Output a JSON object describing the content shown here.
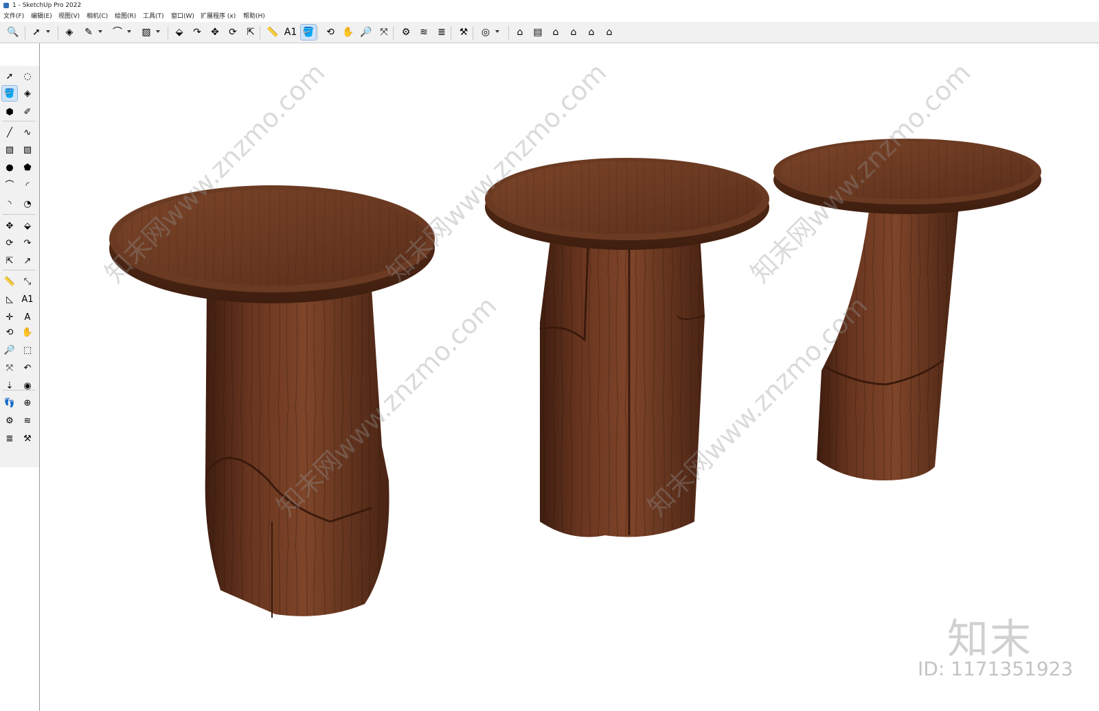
{
  "window": {
    "title": "1 - SketchUp Pro 2022"
  },
  "menu": [
    {
      "label": "文件(F)"
    },
    {
      "label": "编辑(E)"
    },
    {
      "label": "视图(V)"
    },
    {
      "label": "相机(C)"
    },
    {
      "label": "绘图(R)"
    },
    {
      "label": "工具(T)"
    },
    {
      "label": "窗口(W)"
    },
    {
      "label": "扩展程序 (x)"
    },
    {
      "label": "帮助(H)"
    }
  ],
  "top_toolbar": [
    {
      "icon": "zoom-icon",
      "glyph": "🔍"
    },
    {
      "icon": "select-icon",
      "glyph": "➚",
      "dropdown": true
    },
    {
      "icon": "eraser-icon",
      "glyph": "◈"
    },
    {
      "icon": "pencil-icon",
      "glyph": "✎",
      "dropdown": true
    },
    {
      "icon": "arc-icon",
      "glyph": "⌒",
      "dropdown": true
    },
    {
      "icon": "rectangle-icon",
      "glyph": "▨",
      "dropdown": true
    },
    {
      "icon": "push-pull-icon",
      "glyph": "⬙"
    },
    {
      "icon": "follow-me-icon",
      "glyph": "↷"
    },
    {
      "icon": "move-icon",
      "glyph": "✥"
    },
    {
      "icon": "rotate-icon",
      "glyph": "⟳"
    },
    {
      "icon": "scale-icon",
      "glyph": "⇱"
    },
    {
      "icon": "tape-measure-icon",
      "glyph": "📏"
    },
    {
      "icon": "text-icon",
      "glyph": "A1"
    },
    {
      "icon": "paint-bucket-icon",
      "glyph": "🪣",
      "active": true
    },
    {
      "icon": "orbit-icon",
      "glyph": "⟲"
    },
    {
      "icon": "pan-icon",
      "glyph": "✋"
    },
    {
      "icon": "zoom-tool-icon",
      "glyph": "🔎"
    },
    {
      "icon": "zoom-extents-icon",
      "glyph": "⤧"
    },
    {
      "icon": "warehouse-icon",
      "glyph": "⚙"
    },
    {
      "icon": "extension-warehouse-icon",
      "glyph": "≋"
    },
    {
      "icon": "layers-icon",
      "glyph": "≣"
    },
    {
      "icon": "extension-manager-icon",
      "glyph": "⚒"
    },
    {
      "icon": "account-icon",
      "glyph": "◎",
      "dropdown": true
    },
    {
      "icon": "iso-view-icon",
      "glyph": "⌂"
    },
    {
      "icon": "top-view-icon",
      "glyph": "▤"
    },
    {
      "icon": "front-view-icon",
      "glyph": "⌂"
    },
    {
      "icon": "right-view-icon",
      "glyph": "⌂"
    },
    {
      "icon": "back-view-icon",
      "glyph": "⌂"
    },
    {
      "icon": "left-view-icon",
      "glyph": "⌂"
    }
  ],
  "left_toolbar": [
    {
      "icon": "select-icon",
      "glyph": "➚"
    },
    {
      "icon": "lasso-icon",
      "glyph": "◌"
    },
    {
      "icon": "paint-bucket-icon",
      "glyph": "🪣",
      "active": true
    },
    {
      "icon": "eraser-icon",
      "glyph": "◈"
    },
    {
      "icon": "make-component-icon",
      "glyph": "⬢"
    },
    {
      "icon": "tag-tool-icon",
      "glyph": "✐"
    },
    {
      "icon": "line-icon",
      "glyph": "╱"
    },
    {
      "icon": "freehand-icon",
      "glyph": "∿"
    },
    {
      "icon": "rectangle-icon",
      "glyph": "▨"
    },
    {
      "icon": "rotated-rectangle-icon",
      "glyph": "▧"
    },
    {
      "icon": "circle-icon",
      "glyph": "●"
    },
    {
      "icon": "polygon-icon",
      "glyph": "⬟"
    },
    {
      "icon": "arc-icon",
      "glyph": "⌒"
    },
    {
      "icon": "two-point-arc-icon",
      "glyph": "◜"
    },
    {
      "icon": "three-point-arc-icon",
      "glyph": "◝"
    },
    {
      "icon": "pie-icon",
      "glyph": "◔"
    },
    {
      "icon": "move-icon",
      "glyph": "✥"
    },
    {
      "icon": "push-pull-icon",
      "glyph": "⬙"
    },
    {
      "icon": "rotate-icon",
      "glyph": "⟳"
    },
    {
      "icon": "follow-me-icon",
      "glyph": "↷"
    },
    {
      "icon": "scale-icon",
      "glyph": "⇱"
    },
    {
      "icon": "offset-icon",
      "glyph": "↗"
    },
    {
      "icon": "tape-measure-icon",
      "glyph": "📏"
    },
    {
      "icon": "dimension-icon",
      "glyph": "⤡"
    },
    {
      "icon": "protractor-icon",
      "glyph": "◺"
    },
    {
      "icon": "text-icon",
      "glyph": "A1"
    },
    {
      "icon": "axes-icon",
      "glyph": "✛"
    },
    {
      "icon": "3d-text-icon",
      "glyph": "A"
    },
    {
      "icon": "orbit-icon",
      "glyph": "⟲"
    },
    {
      "icon": "pan-icon",
      "glyph": "✋"
    },
    {
      "icon": "zoom-icon",
      "glyph": "🔎"
    },
    {
      "icon": "zoom-window-icon",
      "glyph": "⬚"
    },
    {
      "icon": "zoom-extents-icon",
      "glyph": "⤧"
    },
    {
      "icon": "previous-view-icon",
      "glyph": "↶"
    },
    {
      "icon": "position-camera-icon",
      "glyph": "⇣"
    },
    {
      "icon": "look-around-icon",
      "glyph": "◉"
    },
    {
      "icon": "walk-icon",
      "glyph": "👣"
    },
    {
      "icon": "section-plane-icon",
      "glyph": "⊕"
    },
    {
      "icon": "warehouse-icon",
      "glyph": "⚙"
    },
    {
      "icon": "extension-warehouse-icon",
      "glyph": "≋"
    },
    {
      "icon": "layers-icon",
      "glyph": "≣"
    },
    {
      "icon": "extension-manager-icon",
      "glyph": "⚒"
    }
  ],
  "watermark": {
    "repeat_text": "知末网www.znzmo.com",
    "logo": "知末",
    "id_label": "ID: 1171351923"
  },
  "colors": {
    "wood_dark": "#4a2413",
    "wood_mid": "#6b3a22",
    "wood_light": "#8a5535",
    "toolbar_bg": "#f1f1f1",
    "active_tool": "#cfe3f7"
  }
}
